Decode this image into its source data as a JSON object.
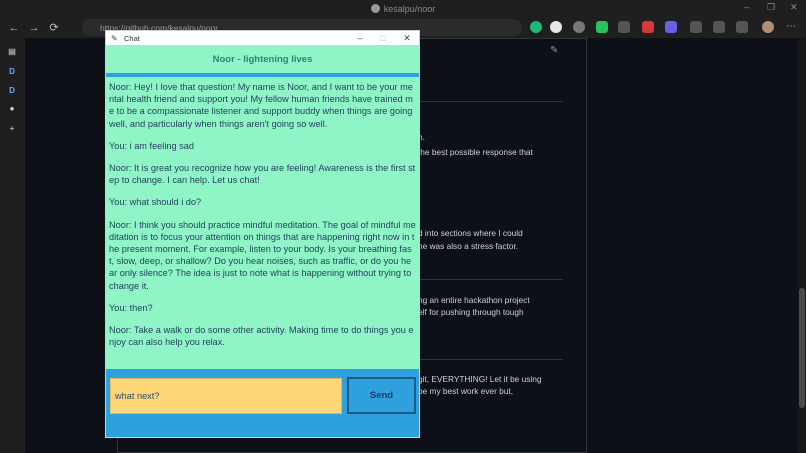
{
  "browser": {
    "window_title": "kesalpu/noor",
    "address": "https://github.com/kesalpu/noor",
    "nav": {
      "back": "←",
      "forward": "→",
      "reload": "⟳"
    }
  },
  "sidebar": {
    "items": [
      "D",
      "D"
    ]
  },
  "page": {
    "snippets": [
      "h.",
      "the best possible response that",
      "d into sections where I could",
      "ne was also a stress factor.",
      "ng an entire hackathon project",
      "elf for pushing through tough",
      "git, EVERYTHING! Let it be using",
      "be my best work ever but,"
    ]
  },
  "chat": {
    "window_title": "Chat",
    "header": "Noor - lightening lives",
    "messages": [
      "Noor: Hey! I love that question! My name is Noor, and I want to be your mental health friend and support you! My fellow human friends have trained me to be a compassionate listener and support buddy when things are going well, and particularly when things aren't going so well.",
      "You: i am feeling sad",
      "Noor: It is great you recognize how you are feeling! Awareness is the first step to change. I can help. Let us chat!",
      "You: what should i do?",
      "Noor: I think you should practice mindful meditation. The goal of mindful meditation is to focus your attention on things that are happening right now in the present moment. For example, listen to your body. Is your breathing fast, slow, deep, or shallow? Do you hear noises, such as traffic, or do you hear only silence? The idea is just to note what is happening without trying to change it.",
      "You: then?",
      "Noor: Take a walk or do some other activity. Making time to do things you enjoy can also help you relax."
    ],
    "input_value": "what next?",
    "send_label": "Send",
    "win_buttons": {
      "minimize": "–",
      "maximize": "□",
      "close": "✕"
    }
  },
  "colors": {
    "chat_bg": "#8ff5c7",
    "chat_frame": "#2ea0dd",
    "input_bg": "#fdd777",
    "header_text": "#1f8a7a"
  }
}
